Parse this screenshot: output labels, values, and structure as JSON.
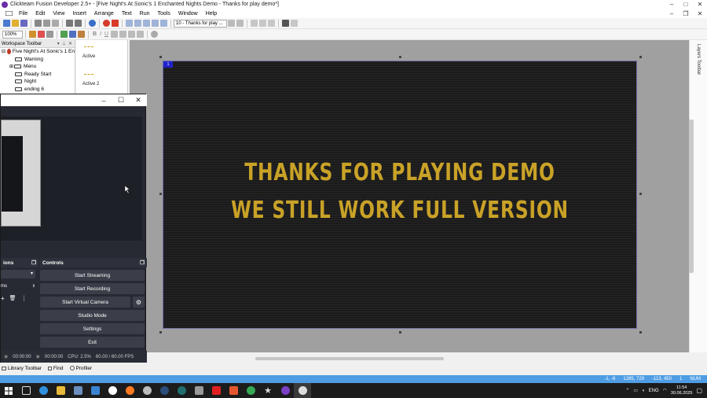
{
  "window": {
    "title": "Clickteam Fusion Developer 2.5+ - [Five Night's At Sonic's 1 Enchanted Nights Demo - Thanks for play demo*]",
    "minimize": "–",
    "maximize": "□",
    "close": "✕",
    "icon": "app-icon"
  },
  "menu": {
    "items": [
      "Edit",
      "View",
      "Insert",
      "Arrange",
      "Text",
      "Run",
      "Tools",
      "Window",
      "Help"
    ],
    "file": "File"
  },
  "toolbar": {
    "zoom": "100%",
    "frame_select": "10 - Thanks for play ..."
  },
  "workspace": {
    "title": "Workspace Toolbar",
    "root": "Five Night's At Sonic's 1 En",
    "frames": [
      "Warning",
      "Menu",
      "Ready Start",
      "Night",
      "ending 6"
    ]
  },
  "frame_list": {
    "item1": "Active",
    "item2": "Active 2"
  },
  "frame": {
    "label": "1",
    "line1": "THANKS FOR PLAYING DEMO",
    "line2": "WE STILL WORK FULL VERSION",
    "text_color": "#c9a227"
  },
  "layers": {
    "title": "Layers Toolbar"
  },
  "obs": {
    "minimize": "–",
    "maximize": "☐",
    "close": "✕",
    "panel_left": "ions",
    "controls_title": "Controls",
    "source_item": "ms",
    "buttons": [
      "Start Streaming",
      "Start Recording",
      "Start Virtual Camera",
      "Studio Mode",
      "Settings",
      "Exit"
    ],
    "status": {
      "rec_time1": "00:00:00",
      "rec_time2": "00:00:00",
      "cpu": "CPU: 2.5%",
      "fps": "60.00 / 60.00 FPS"
    }
  },
  "bottom_tabs": {
    "library": "Library Toolbar",
    "find": "Find",
    "profiler": "Profiler"
  },
  "statusbar": {
    "coords": "-1, -6",
    "size": "1285, 729",
    "pos": "-113, 450",
    "layer": "1",
    "num": "NUM"
  },
  "taskbar": {
    "lang": "ENG",
    "time": "11:54",
    "date": "30.06.2025"
  }
}
